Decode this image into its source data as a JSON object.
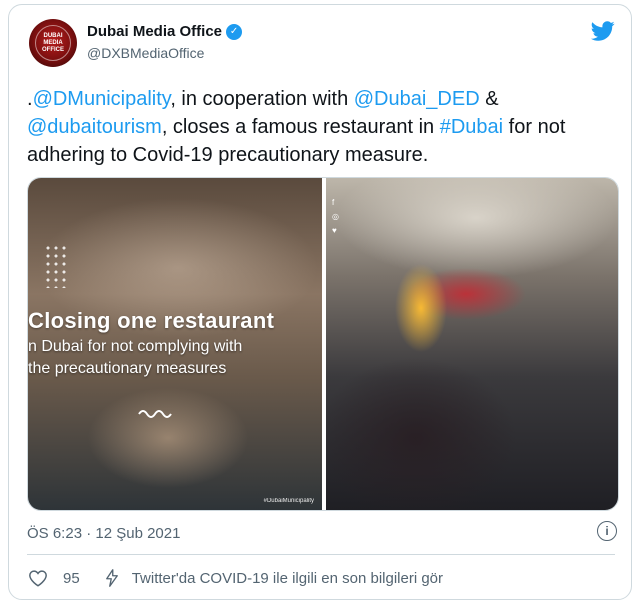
{
  "author": {
    "name": "Dubai Media Office",
    "handle": "@DXBMediaOffice",
    "avatar_text": "DUBAI MEDIA OFFICE"
  },
  "tweet": {
    "prefix": ".",
    "mention1": "@DMunicipality",
    "text1": ", in cooperation with ",
    "mention2": "@Dubai_DED",
    "text2": " & ",
    "mention3": "@dubaitourism",
    "text3": ", closes a famous restaurant in ",
    "hashtag": "#Dubai",
    "text4": " for not adhering to Covid-19 precautionary measure."
  },
  "media": {
    "headline": "Closing one restaurant",
    "sub1": "n Dubai for not complying with",
    "sub2": "the precautionary measures",
    "tag": "#DubaiMunicipality",
    "social": "f\n◎\n♥"
  },
  "meta": {
    "timestamp": "ÖS 6:23 · 12 Şub 2021"
  },
  "actions": {
    "likes": "95",
    "covid_link": "Twitter'da COVID-19 ile ilgili en son bilgileri gör"
  },
  "colors": {
    "link": "#1d9bf0",
    "muted": "#536471",
    "border": "#cfd9de"
  }
}
